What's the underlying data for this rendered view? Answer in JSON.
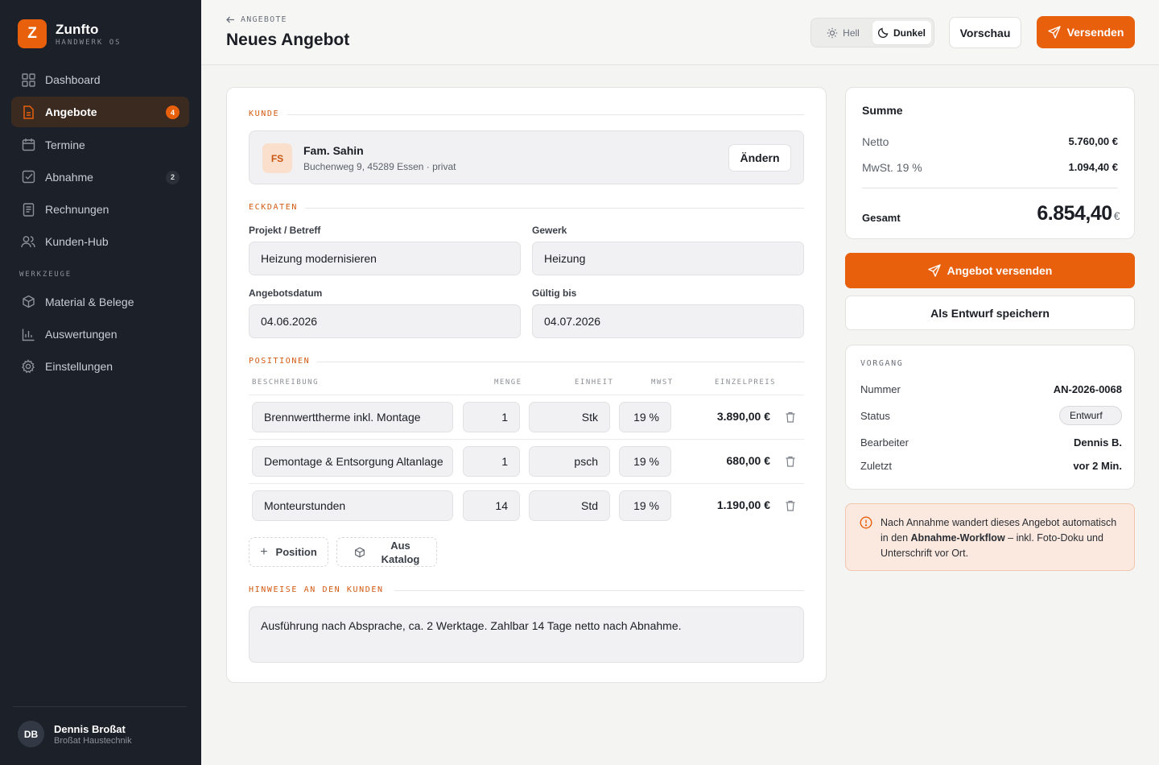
{
  "brand": {
    "name": "Zunfto",
    "subtitle": "HANDWERK OS",
    "logo_letter": "Z",
    "accent": "#e8600c"
  },
  "sidebar": {
    "items": [
      {
        "label": "Dashboard",
        "icon": "grid-icon",
        "badge": null
      },
      {
        "label": "Angebote",
        "icon": "document-icon",
        "badge": "4",
        "active": true
      },
      {
        "label": "Termine",
        "icon": "calendar-icon",
        "badge": null
      },
      {
        "label": "Abnahme",
        "icon": "checkbox-icon",
        "badge": "2"
      },
      {
        "label": "Rechnungen",
        "icon": "receipt-icon",
        "badge": null
      },
      {
        "label": "Kunden-Hub",
        "icon": "users-icon",
        "badge": null
      }
    ],
    "section_tools": "WERKZEUGE",
    "tools": [
      {
        "label": "Material & Belege",
        "icon": "box-icon"
      },
      {
        "label": "Auswertungen",
        "icon": "bar-chart-icon"
      },
      {
        "label": "Einstellungen",
        "icon": "gear-icon"
      }
    ],
    "user": {
      "initials": "DB",
      "name": "Dennis Broßat",
      "company": "Broßat Haustechnik"
    }
  },
  "header": {
    "breadcrumb": "ANGEBOTE",
    "title": "Neues Angebot",
    "theme_light": "Hell",
    "theme_dark": "Dunkel",
    "preview_label": "Vorschau",
    "send_label": "Versenden"
  },
  "form": {
    "customer_section": "KUNDE",
    "customer": {
      "initials": "FS",
      "name": "Fam. Sahin",
      "address": "Buchenweg 9, 45289 Essen · privat",
      "change_label": "Ändern"
    },
    "details_section": "ECKDATEN",
    "project_label": "Projekt / Betreff",
    "project_value": "Heizung modernisieren",
    "trade_label": "Gewerk",
    "trade_value": "Heizung",
    "date_label": "Angebotsdatum",
    "date_value": "04.06.2026",
    "valid_label": "Gültig bis",
    "valid_value": "04.07.2026",
    "positions_section": "POSITIONEN",
    "columns": {
      "description": "BESCHREIBUNG",
      "quantity": "MENGE",
      "unit": "EINHEIT",
      "vat": "MWST",
      "unit_price": "EINZELPREIS"
    },
    "positions": [
      {
        "description": "Brennwerttherme inkl. Montage",
        "quantity": "1",
        "unit": "Stk",
        "vat": "19 %",
        "price": "3.890,00 €"
      },
      {
        "description": "Demontage & Entsorgung Altanlage",
        "quantity": "1",
        "unit": "psch",
        "vat": "19 %",
        "price": "680,00 €"
      },
      {
        "description": "Monteurstunden",
        "quantity": "14",
        "unit": "Std",
        "vat": "19 %",
        "price": "1.190,00 €"
      }
    ],
    "add_position_label": "Position",
    "catalog_label_1": "Aus",
    "catalog_label_2": "Katalog",
    "notes_section": "HINWEISE AN DEN KUNDEN",
    "notes_value": "Ausführung nach Absprache, ca. 2 Werktage. Zahlbar 14 Tage netto nach Abnahme."
  },
  "summary": {
    "title": "Summe",
    "net_label": "Netto",
    "net_value": "5.760,00 €",
    "vat_label": "MwSt. 19 %",
    "vat_value": "1.094,40 €",
    "total_label": "Gesamt",
    "total_value": "6.854,40",
    "currency": "€"
  },
  "actions": {
    "send_offer": "Angebot versenden",
    "save_draft": "Als Entwurf speichern"
  },
  "process": {
    "title": "VORGANG",
    "number_label": "Nummer",
    "number_value": "AN-2026-0068",
    "status_label": "Status",
    "status_value": "Entwurf",
    "editor_label": "Bearbeiter",
    "editor_value": "Dennis B.",
    "last_label": "Zuletzt",
    "last_value": "vor 2 Min."
  },
  "info": {
    "text_before": "Nach Annahme wandert dieses Angebot automatisch in den ",
    "text_bold": "Abnahme-Workflow",
    "text_after": " – inkl. Foto-Doku und Unterschrift vor Ort."
  }
}
